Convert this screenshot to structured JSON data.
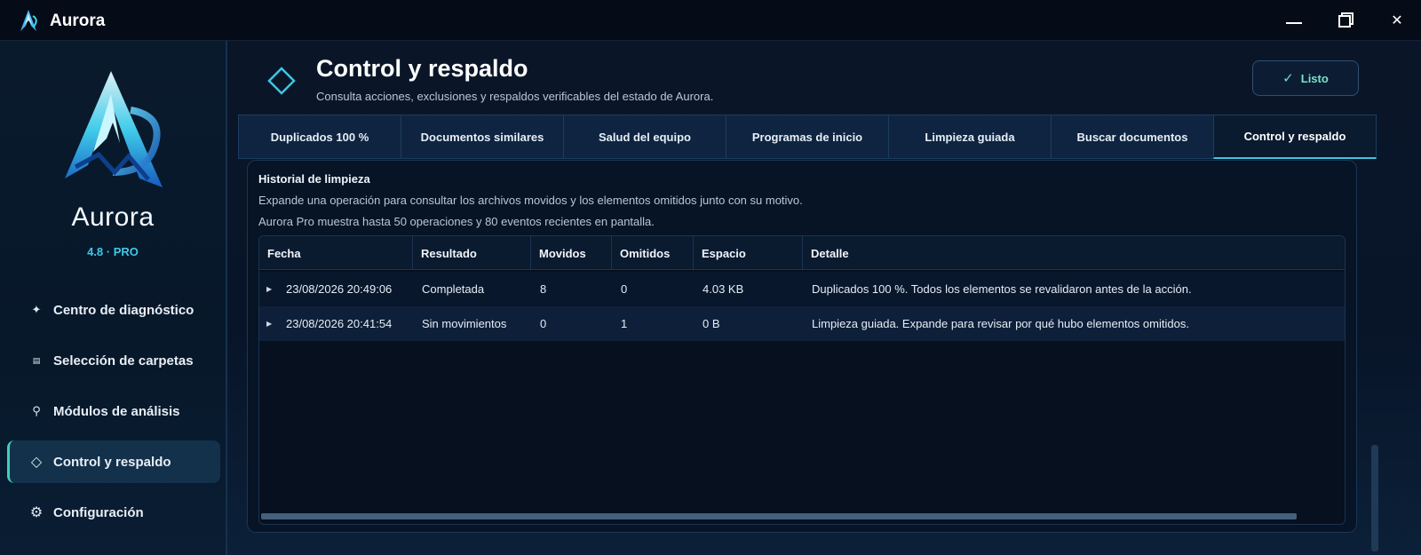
{
  "window": {
    "title": "Aurora",
    "controls": {
      "minimize": "—",
      "maximize": "❐",
      "close": "✕"
    }
  },
  "sidebar": {
    "brand_name": "Aurora",
    "version": "4.8 · PRO",
    "items": [
      {
        "label": "Centro de diagnóstico",
        "icon": "sparkle-icon",
        "glyph": "✦",
        "active": false
      },
      {
        "label": "Selección de carpetas",
        "icon": "folder-icon",
        "glyph": "▤",
        "active": false
      },
      {
        "label": "Módulos de análisis",
        "icon": "search-icon",
        "glyph": "⚲",
        "active": false
      },
      {
        "label": "Control y respaldo",
        "icon": "diamond-icon",
        "glyph": "◇",
        "active": true
      },
      {
        "label": "Configuración",
        "icon": "gear-icon",
        "glyph": "⚙",
        "active": false
      }
    ]
  },
  "header": {
    "title": "Control y respaldo",
    "subtitle": "Consulta acciones, exclusiones y respaldos verificables del estado de Aurora.",
    "done_button": "Listo",
    "done_icon": "✓"
  },
  "tabs": [
    {
      "label": "Duplicados 100 %",
      "active": false
    },
    {
      "label": "Documentos similares",
      "active": false
    },
    {
      "label": "Salud del equipo",
      "active": false
    },
    {
      "label": "Programas de inicio",
      "active": false
    },
    {
      "label": "Limpieza guiada",
      "active": false
    },
    {
      "label": "Buscar documentos",
      "active": false
    },
    {
      "label": "Control y respaldo",
      "active": true
    }
  ],
  "history": {
    "title": "Historial de limpieza",
    "description": "Expande una operación para consultar los archivos movidos y los elementos omitidos junto con su motivo.",
    "limit_note": "Aurora Pro muestra hasta 50 operaciones y 80 eventos recientes en pantalla.",
    "columns": [
      "Fecha",
      "Resultado",
      "Movidos",
      "Omitidos",
      "Espacio",
      "Detalle"
    ],
    "rows": [
      [
        "23/08/2026 20:49:06",
        "Completada",
        "8",
        "0",
        "4.03 KB",
        "Duplicados 100 %. Todos los elementos se revalidaron antes de la acción."
      ],
      [
        "23/08/2026 20:41:54",
        "Sin movimientos",
        "0",
        "1",
        "0 B",
        "Limpieza guiada. Expande para revisar por qué hubo elementos omitidos."
      ]
    ],
    "expander_glyph": "▶"
  },
  "colors": {
    "accent": "#3fc4e0",
    "active_indicator": "#3fd2b4",
    "background": "#07111f",
    "done_text": "#7ee0c8"
  }
}
